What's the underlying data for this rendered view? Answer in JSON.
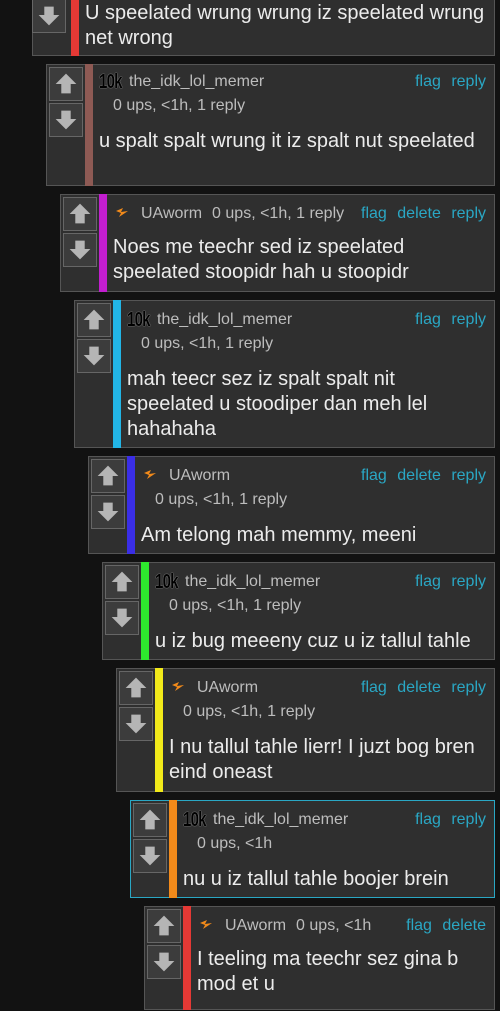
{
  "colors": {
    "background": "#121212",
    "card": "#2f2f2f",
    "link": "#2aa7c4",
    "depth_bars": [
      "#e53935",
      "#8e5a54",
      "#c21ecf",
      "#22b5e6",
      "#3a2ee6",
      "#2ee82e",
      "#f2ea1a",
      "#f28a1a",
      "#e53935"
    ]
  },
  "icons": {
    "upvote": "arrow-up-icon",
    "downvote": "arrow-down-icon",
    "user_badge_10k": "10k-badge",
    "user_badge_bolt": "lightning-bolt-icon"
  },
  "comments": [
    {
      "text": "U speelated wrung wrung iz speelated wrung net wrong"
    },
    {
      "badge": "10k",
      "user": "the_idk_lol_memer",
      "stats": "0 ups, <1h, 1 reply",
      "actions": [
        "flag",
        "reply"
      ],
      "text": "u spalt spalt wrung it iz spalt nut speelated"
    },
    {
      "user": "UAworm",
      "stats": "0 ups, <1h, 1 reply",
      "actions": [
        "flag",
        "delete",
        "reply"
      ],
      "text": "Noes me teechr sed iz speelated speelated stoopidr hah u stoopidr"
    },
    {
      "badge": "10k",
      "user": "the_idk_lol_memer",
      "stats": "0 ups, <1h, 1 reply",
      "actions": [
        "flag",
        "reply"
      ],
      "text": "mah teecr sez iz spalt spalt nit speelated u stoodiper dan meh lel hahahaha"
    },
    {
      "user": "UAworm",
      "stats": "0 ups, <1h, 1 reply",
      "actions": [
        "flag",
        "delete",
        "reply"
      ],
      "text": "Am telong mah memmy, meeni"
    },
    {
      "badge": "10k",
      "user": "the_idk_lol_memer",
      "stats": "0 ups, <1h, 1 reply",
      "actions": [
        "flag",
        "reply"
      ],
      "text": "u iz bug meeeny cuz u iz tallul tahle"
    },
    {
      "user": "UAworm",
      "stats": "0 ups, <1h, 1 reply",
      "actions": [
        "flag",
        "delete",
        "reply"
      ],
      "text": "I nu tallul tahle lierr! I juzt bog bren eind oneast"
    },
    {
      "badge": "10k",
      "user": "the_idk_lol_memer",
      "stats": "0 ups, <1h",
      "actions": [
        "flag",
        "reply"
      ],
      "text": "nu u iz tallul tahle boojer brein"
    },
    {
      "user": "UAworm",
      "stats": "0 ups, <1h",
      "actions": [
        "flag",
        "delete"
      ],
      "text": "I teeling ma teechr sez gina b mod et u"
    }
  ]
}
